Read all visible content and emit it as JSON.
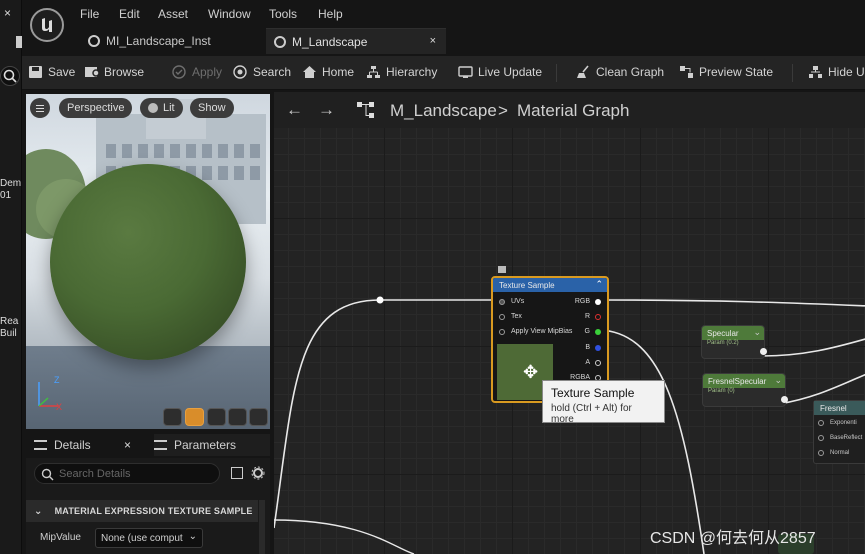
{
  "left_strip": {
    "close": "×",
    "label_top": "Dem\n01",
    "label_bottom": "Rea\nBuil"
  },
  "menu": {
    "items": [
      "File",
      "Edit",
      "Asset",
      "Window",
      "Tools",
      "Help"
    ]
  },
  "tabs": [
    {
      "label": "MI_Landscape_Inst",
      "active": false
    },
    {
      "label": "M_Landscape",
      "active": true,
      "close": "×"
    }
  ],
  "toolbar": {
    "save": "Save",
    "browse": "Browse",
    "apply": "Apply",
    "search": "Search",
    "home": "Home",
    "hierarchy": "Hierarchy",
    "live_update": "Live Update",
    "clean_graph": "Clean Graph",
    "preview_state": "Preview State",
    "hide_unrelated": "Hide U"
  },
  "viewport": {
    "perspective": "Perspective",
    "lit": "Lit",
    "show": "Show",
    "axis_z": "Z",
    "axis_x": "X",
    "sphere_color": "#4a6a34"
  },
  "details": {
    "tab_details": "Details",
    "tab_close": "×",
    "tab_parameters": "Parameters",
    "search_placeholder": "Search Details",
    "section": "MATERIAL EXPRESSION TEXTURE SAMPLE",
    "mip_label": "MipValue",
    "mip_value": "None (use comput"
  },
  "graph": {
    "crumb_root": "M_Landscape",
    "crumb_sep": ">",
    "crumb_leaf": "Material Graph",
    "texture_node": {
      "title": "Texture Sample",
      "inputs": [
        "UVs",
        "Tex",
        "Apply View MipBias"
      ],
      "outputs": [
        "RGB",
        "R",
        "G",
        "B",
        "A",
        "RGBA"
      ]
    },
    "specular_node": {
      "title": "Specular",
      "sub": "Param (0.2)"
    },
    "fresnel_specular_node": {
      "title": "FresnelSpecular",
      "sub": "Param (0)"
    },
    "fresnel_node": {
      "title": "Fresnel",
      "inputs": [
        "Exponenti",
        "BaseReflect",
        "Normal"
      ]
    },
    "tooltip": {
      "title": "Texture Sample",
      "hint": "hold (Ctrl + Alt) for more"
    }
  },
  "watermark": "CSDN @何去何从2857"
}
